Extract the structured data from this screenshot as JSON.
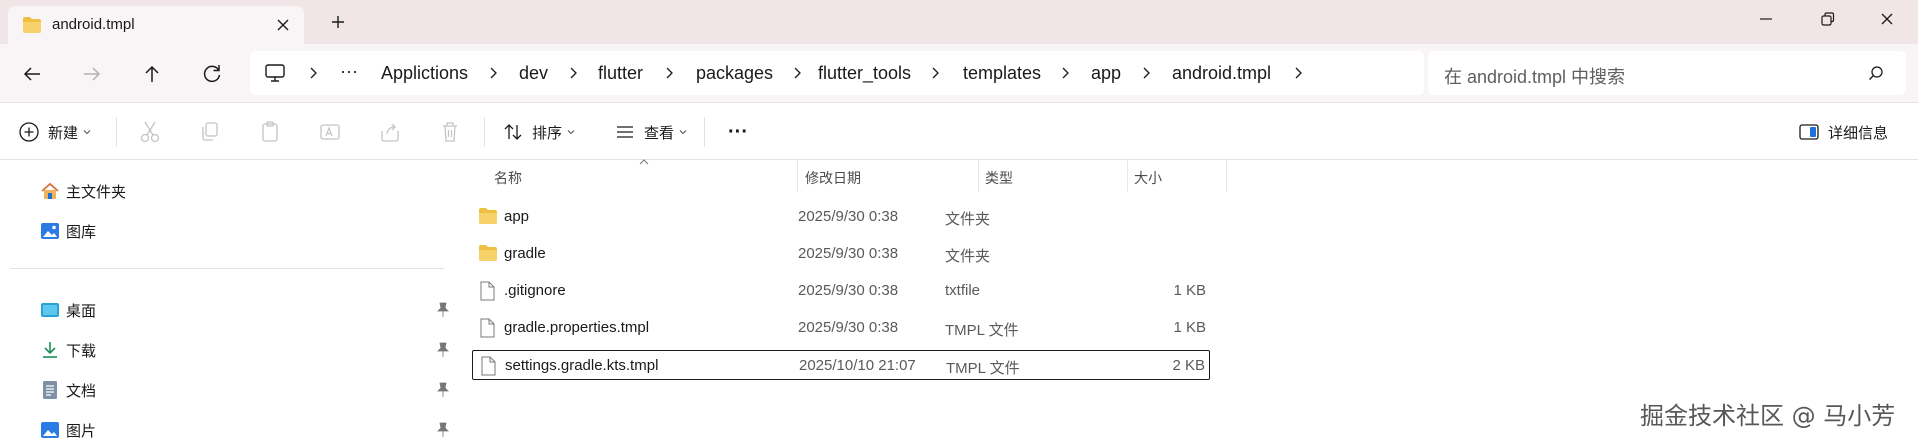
{
  "tab": {
    "title": "android.tmpl"
  },
  "breadcrumb": {
    "more": "···",
    "items": [
      "Applictions",
      "dev",
      "flutter",
      "packages",
      "flutter_tools",
      "templates",
      "app",
      "android.tmpl"
    ]
  },
  "search": {
    "placeholder": "在 android.tmpl 中搜索"
  },
  "toolbar": {
    "new_label": "新建",
    "sort_label": "排序",
    "view_label": "查看",
    "more_label": "···",
    "details_label": "详细信息"
  },
  "sidebar": {
    "top_items": [
      {
        "label": "主文件夹",
        "icon": "home-icon"
      },
      {
        "label": "图库",
        "icon": "gallery-icon"
      }
    ],
    "pinned_items": [
      {
        "label": "桌面",
        "icon": "desktop-icon"
      },
      {
        "label": "下载",
        "icon": "download-icon"
      },
      {
        "label": "文档",
        "icon": "documents-icon"
      },
      {
        "label": "图片",
        "icon": "pictures-icon"
      }
    ]
  },
  "columns": {
    "name": "名称",
    "modified": "修改日期",
    "type": "类型",
    "size": "大小"
  },
  "files": [
    {
      "name": "app",
      "modified": "2025/9/30 0:38",
      "type": "文件夹",
      "size": "",
      "icon": "folder-icon",
      "selected": false
    },
    {
      "name": "gradle",
      "modified": "2025/9/30 0:38",
      "type": "文件夹",
      "size": "",
      "icon": "folder-icon",
      "selected": false
    },
    {
      "name": ".gitignore",
      "modified": "2025/9/30 0:38",
      "type": "txtfile",
      "size": "1 KB",
      "icon": "file-icon",
      "selected": false
    },
    {
      "name": "gradle.properties.tmpl",
      "modified": "2025/9/30 0:38",
      "type": "TMPL 文件",
      "size": "1 KB",
      "icon": "file-icon",
      "selected": false
    },
    {
      "name": "settings.gradle.kts.tmpl",
      "modified": "2025/10/10 21:07",
      "type": "TMPL 文件",
      "size": "2 KB",
      "icon": "file-icon",
      "selected": true
    }
  ],
  "watermark": "掘金技术社区 @ 马小芳",
  "colors": {
    "titlebar": "#f1e6e7",
    "toolbar": "#f9f4f5",
    "folder": "#f0c043",
    "accent": "#1e6fd9"
  }
}
